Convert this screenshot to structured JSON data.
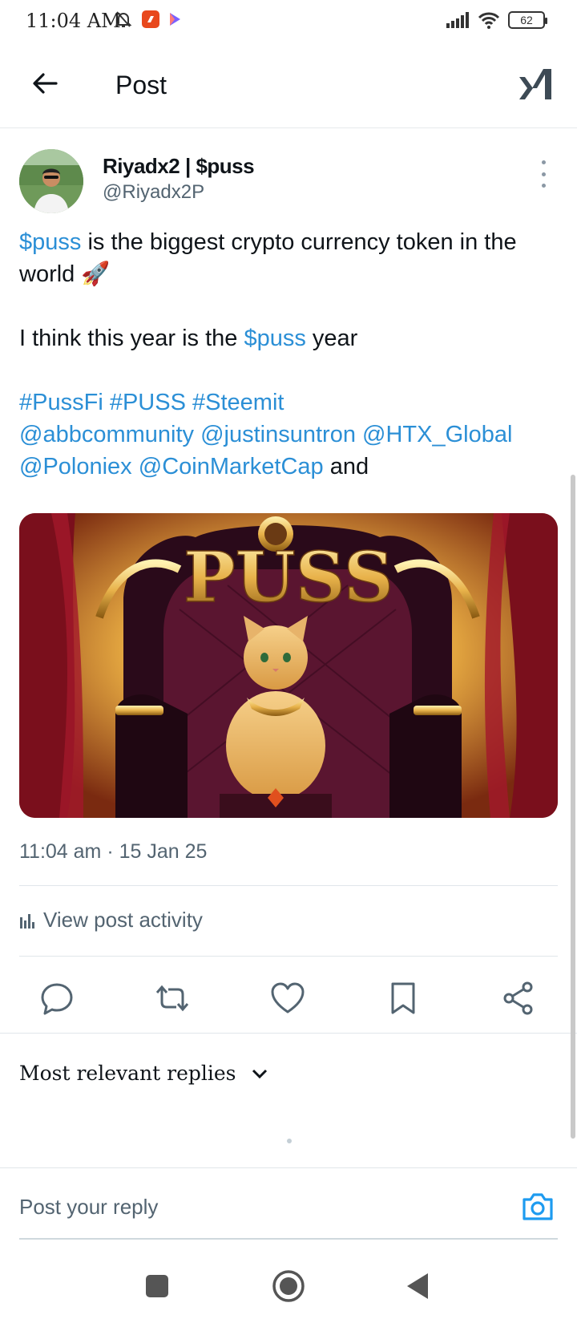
{
  "status_bar": {
    "time": "11:04 AM",
    "battery": "62",
    "icons": [
      "muted-bell-icon",
      "app-notification-icon",
      "play-icon",
      "signal-icon",
      "wifi-icon",
      "battery-icon"
    ]
  },
  "header": {
    "title": "Post",
    "back_icon": "back-arrow-icon",
    "logo_icon": "xai-logo-icon"
  },
  "post": {
    "author_name": "Riyadx2 | $puss",
    "author_handle": "@Riyadx2P",
    "text_line1_link": "$puss",
    "text_line1_rest": " is the biggest crypto currency token in the world ",
    "text_emoji": "🚀",
    "text_line2_pre": "I think this year is the ",
    "text_line2_link": "$puss",
    "text_line2_post": " year",
    "tags": [
      "#PussFi",
      "#PUSS",
      "#Steemit"
    ],
    "mentions": [
      "@abbcommunity",
      "@justinsuntron",
      "@HTX_Global",
      "@Poloniex",
      "@CoinMarketCap"
    ],
    "trailing_text": "and",
    "image_text": "PUSS",
    "timestamp": "11:04 am · 15 Jan 25",
    "activity_label": "View post activity"
  },
  "actions": [
    "reply-icon",
    "repost-icon",
    "like-icon",
    "bookmark-icon",
    "share-icon"
  ],
  "replies": {
    "sort_label": "Most relevant replies",
    "reply_placeholder": "Post your reply"
  },
  "colors": {
    "link": "#2b8fd6",
    "text": "#0f1419",
    "secondary": "#536471"
  }
}
